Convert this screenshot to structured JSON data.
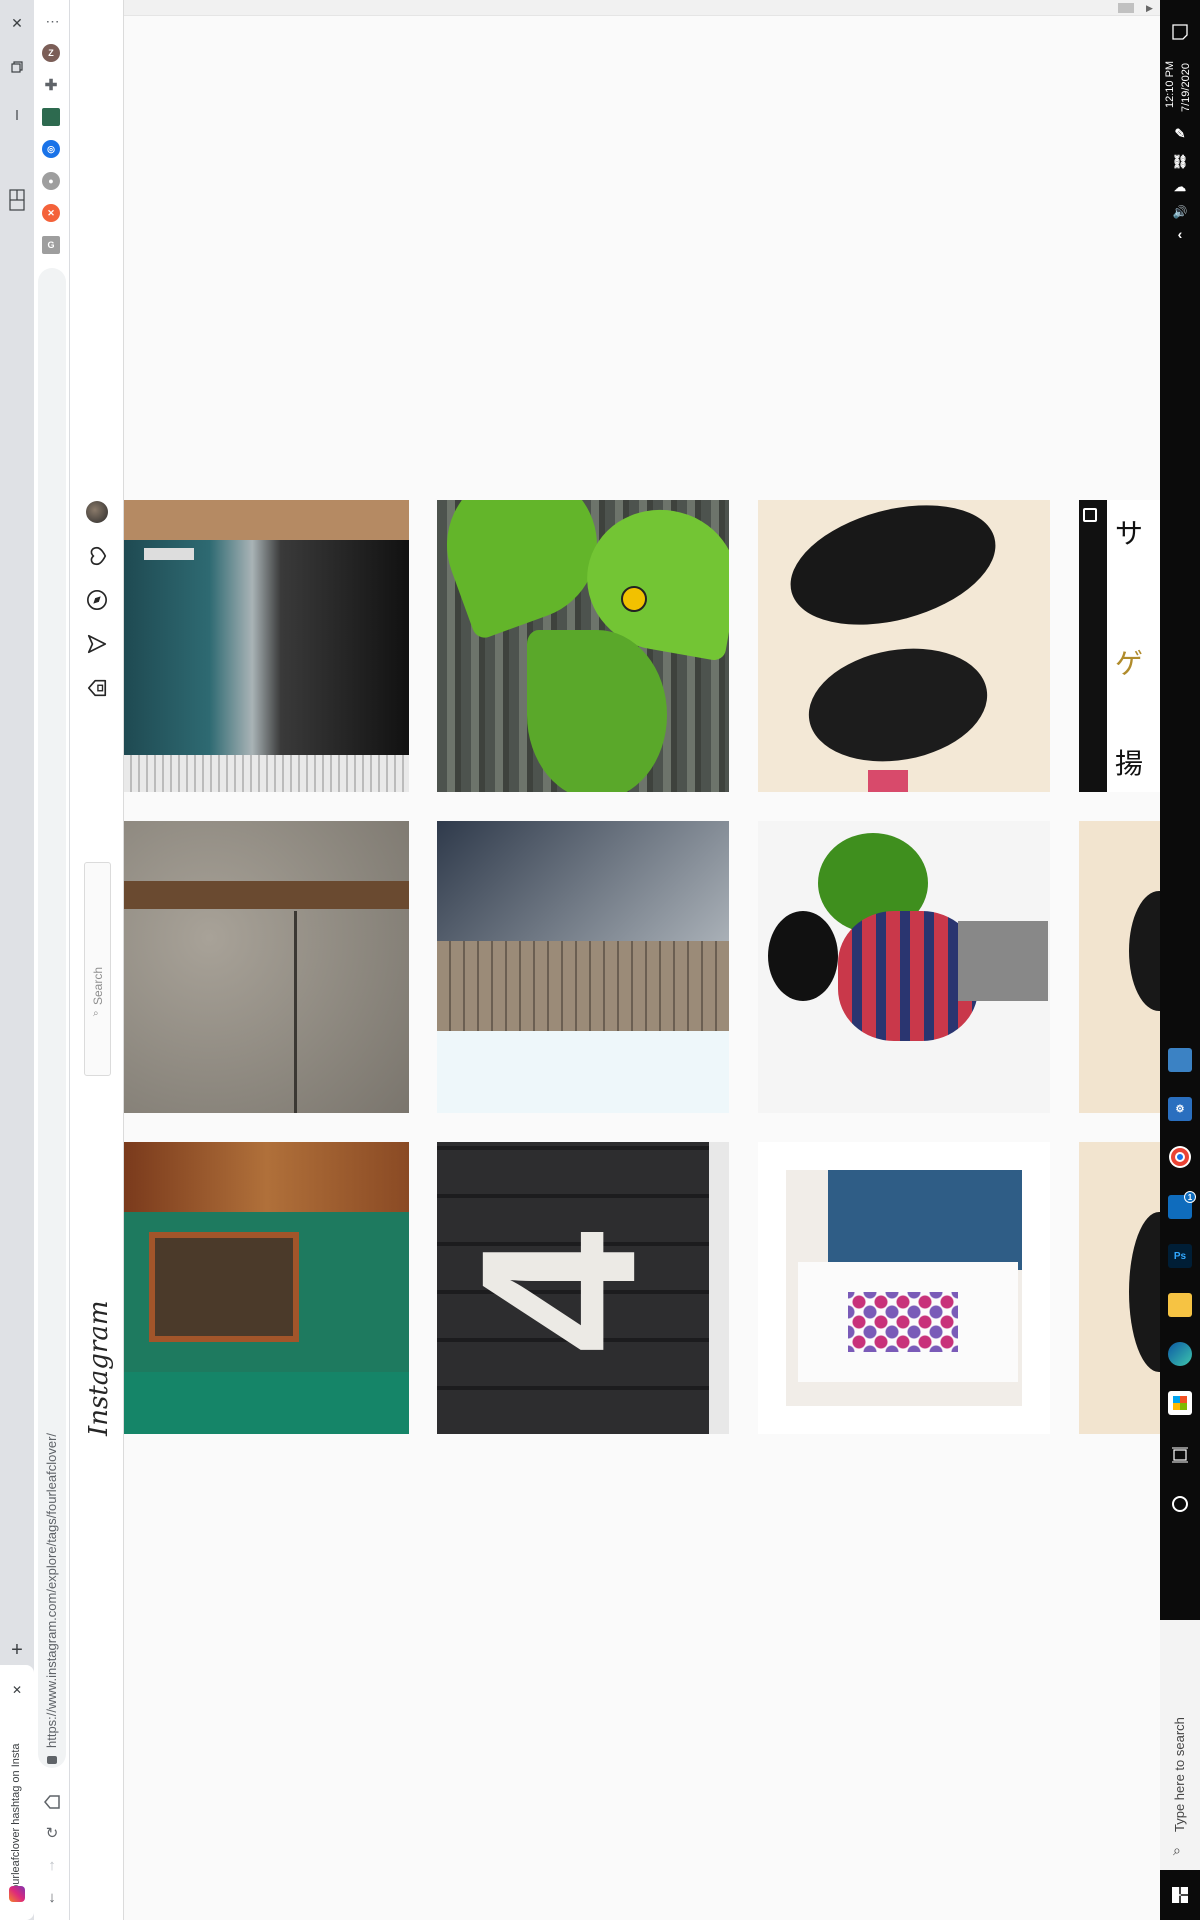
{
  "browser": {
    "tab_title": "#fourleafclover hashtag on Insta",
    "url": "https://www.instagram.com/explore/tags/fourleafclover/",
    "new_tab_symbol": "+",
    "close_symbol": "✕",
    "menu_symbol": "⋯",
    "profile_initial": "Z",
    "ext_grammarly": "G"
  },
  "instagram": {
    "logo": "Instagram",
    "search_placeholder": "Search"
  },
  "taskbar": {
    "time": "12:10 PM",
    "date": "7/19/2020",
    "search_placeholder": "Type here to search",
    "ps_label": "Ps",
    "notification_count": "1"
  },
  "grid": {
    "rows": [
      [
        "building-glass",
        "ladybug-clover",
        "black-cat",
        "japanese-sign"
      ],
      [
        "stone-wall",
        "building-sky",
        "figurine-clover",
        "black-cat-partial"
      ],
      [
        "green-wooden-door",
        "number-four-pavement",
        "shirt-and-jeans",
        "black-cat-partial"
      ]
    ]
  },
  "colors": {
    "accent_blue": "#1a73e8",
    "taskbar_bg": "#0b0b0b",
    "instagram_border": "#dbdbdb"
  }
}
